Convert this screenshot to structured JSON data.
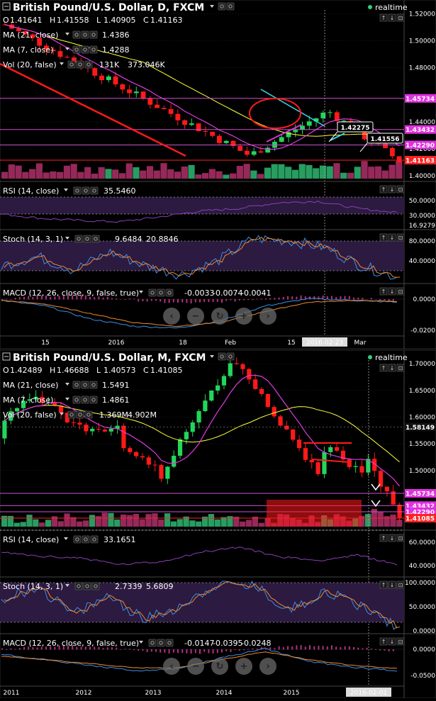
{
  "colors": {
    "bg": "#000000",
    "up": "#22d65b",
    "down": "#ff1a1a",
    "ma21": "#ffff3a",
    "ma7": "#e23ae2",
    "vol_up": "#2fb872",
    "vol_down": "#b0306a",
    "rsi": "#8a3fb8",
    "stoch_k": "#3a8fe8",
    "stoch_d": "#f08a2a",
    "macd": "#3a8fe8",
    "signal": "#f08a2a",
    "hist": "#b03080",
    "hline": "#d04fd0",
    "cyan": "#38d6e8",
    "grid": "#223040",
    "band": "#2c1a40",
    "price_red": "#ff2020"
  },
  "panels": [
    {
      "id": "daily",
      "title": "British Pound/U.S. Dollar, D, FXCM",
      "realtime_label": "realtime",
      "ohlc": {
        "o": "1.41641",
        "h": "1.41558",
        "l": "1.40905",
        "c": "1.41163"
      },
      "ma21": {
        "label": "MA (21, close)",
        "value": "1.4386"
      },
      "ma7": {
        "label": "MA (7, close)",
        "value": "1.4288"
      },
      "vol": {
        "label": "Vol (20, false)",
        "v1": "131K",
        "v2": "373.046K"
      },
      "price_ticks": [
        "1.52000",
        "1.50000",
        "1.48000",
        "1.44000",
        "1.42000",
        "1.40000"
      ],
      "price_tags": [
        {
          "value": "1.45734",
          "kind": "magenta"
        },
        {
          "value": "1.43432",
          "kind": "magenta"
        },
        {
          "value": "1.42290",
          "kind": "magenta"
        },
        {
          "value": "1.41163",
          "kind": "red"
        }
      ],
      "callouts": [
        "1.42275",
        "1.41556"
      ],
      "rsi": {
        "label": "RSI (14, close)",
        "value": "35.5460",
        "ticks": [
          "50.0000",
          "30.0000",
          "16.9279"
        ]
      },
      "stoch": {
        "label": "Stoch (14, 3, 1)",
        "k": "9.6484",
        "d": "20.8846",
        "ticks": [
          "80.0000",
          "40.0000"
        ]
      },
      "macd": {
        "label": "MACD (12, 26, close, 9, false, true)",
        "macd": "-0.0033",
        "signal": "-0.0074",
        "hist": "-0.0041",
        "ticks": [
          "0.0000",
          "-0.0200"
        ]
      },
      "x_ticks": [
        "15",
        "2016",
        "18",
        "Feb",
        "15",
        "Mar"
      ],
      "cursor_date": "2016-02-23"
    },
    {
      "id": "monthly",
      "title": "British Pound/U.S. Dollar, M, FXCM",
      "realtime_label": "realtime",
      "ohlc": {
        "o": "1.42489",
        "h": "1.46688",
        "l": "1.40573",
        "c": "1.41085"
      },
      "ma21": {
        "label": "MA (21, close)",
        "value": "1.5491"
      },
      "ma7": {
        "label": "MA (7, close)",
        "value": "1.4861"
      },
      "vol": {
        "label": "Vol (20, false)",
        "v1": "1.369M",
        "v2": "4.902M"
      },
      "price_ticks": [
        "1.70000",
        "1.65000",
        "1.60000",
        "1.55000",
        "1.50000"
      ],
      "price_tags": [
        {
          "value": "1.58149",
          "kind": "dark"
        },
        {
          "value": "1.45734",
          "kind": "magenta"
        },
        {
          "value": "1.43432",
          "kind": "magenta"
        },
        {
          "value": "1.42290",
          "kind": "magenta"
        },
        {
          "value": "1.41085",
          "kind": "red"
        }
      ],
      "callouts": [],
      "rsi": {
        "label": "RSI (14, close)",
        "value": "33.1651",
        "ticks": [
          "60.0000",
          "40.0000"
        ]
      },
      "stoch": {
        "label": "Stoch (14, 3, 1)",
        "k": "2.7339",
        "d": "5.6809",
        "ticks": [
          "100.0000",
          "50.0000",
          "0.0000"
        ]
      },
      "macd": {
        "label": "MACD (12, 26, close, 9, false, true)",
        "macd": "-0.0147",
        "signal": "-0.0395",
        "hist": "-0.0248",
        "ticks": [
          "0.0000",
          "-0.0500"
        ]
      },
      "x_ticks": [
        "2011",
        "2012",
        "2013",
        "2014",
        "2015"
      ],
      "cursor_date": "2016-02-01"
    }
  ],
  "chart_data": [
    {
      "type": "candlestick",
      "title": "British Pound/U.S. Dollar, D, FXCM",
      "ylim": [
        1.39,
        1.53
      ],
      "yticks": [
        1.52,
        1.5,
        1.48,
        1.44,
        1.42,
        1.4
      ],
      "x": [
        "15",
        "2016",
        "18",
        "Feb",
        "15",
        "Mar"
      ],
      "series": [
        {
          "name": "OHLC last",
          "values": [
            1.41641,
            1.41558,
            1.40905,
            1.41163
          ]
        },
        {
          "name": "MA (21, close)",
          "values": [
            1.4386
          ]
        },
        {
          "name": "MA (7, close)",
          "values": [
            1.4288
          ]
        }
      ],
      "indicators": {
        "RSI (14, close)": 35.546,
        "Stoch %K": 9.6484,
        "Stoch %D": 20.8846,
        "MACD": -0.0033,
        "Signal": -0.0074,
        "Histogram": -0.0041
      },
      "horizontal_levels": [
        1.45734,
        1.43432,
        1.4229,
        1.41163
      ]
    },
    {
      "type": "candlestick",
      "title": "British Pound/U.S. Dollar, M, FXCM",
      "ylim": [
        1.39,
        1.72
      ],
      "yticks": [
        1.7,
        1.65,
        1.6,
        1.55,
        1.5
      ],
      "x": [
        "2011",
        "2012",
        "2013",
        "2014",
        "2015"
      ],
      "series": [
        {
          "name": "OHLC last",
          "values": [
            1.42489,
            1.46688,
            1.40573,
            1.41085
          ]
        },
        {
          "name": "MA (21, close)",
          "values": [
            1.5491
          ]
        },
        {
          "name": "MA (7, close)",
          "values": [
            1.4861
          ]
        }
      ],
      "indicators": {
        "RSI (14, close)": 33.1651,
        "Stoch %K": 2.7339,
        "Stoch %D": 5.6809,
        "MACD": -0.0147,
        "Signal": -0.0395,
        "Histogram": -0.0248
      },
      "horizontal_levels": [
        1.58149,
        1.45734,
        1.43432,
        1.4229,
        1.41085
      ]
    }
  ]
}
